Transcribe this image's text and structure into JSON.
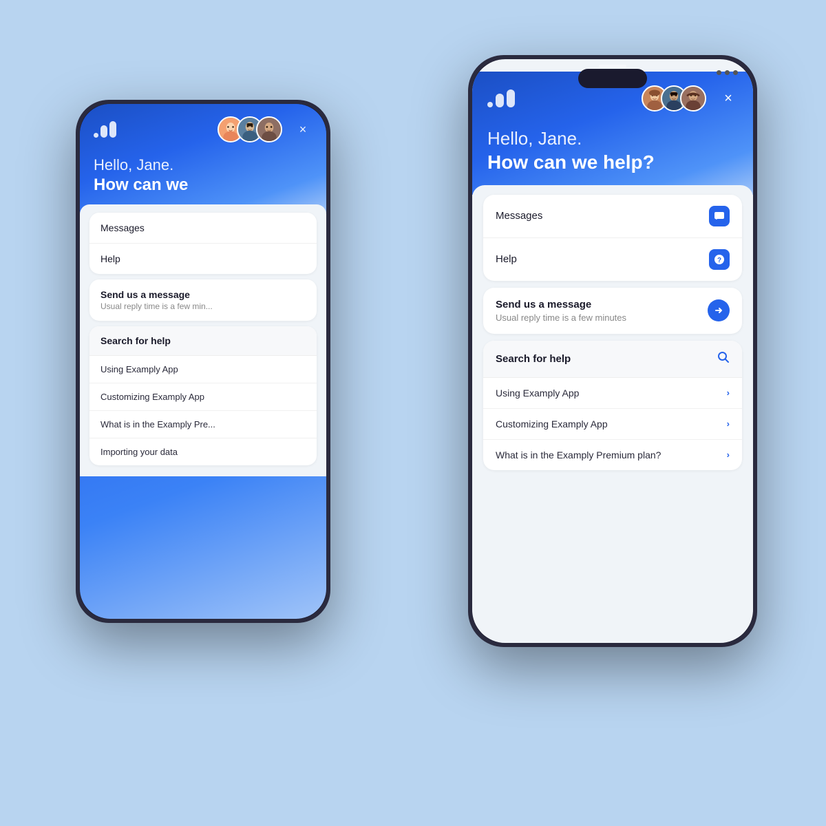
{
  "background_color": "#b8d4f0",
  "back_phone": {
    "greeting_light": "Hello, Jane.",
    "greeting_bold": "How can we",
    "tabs": {
      "messages": "Messages",
      "help": "Help"
    },
    "send_message": {
      "title": "Send us a message",
      "subtitle": "Usual reply time is a few min..."
    },
    "search_for_help": {
      "label": "Search for help",
      "items": [
        "Using Examply App",
        "Customizing Examply App",
        "What is in the Examply Pre...",
        "Importing your data"
      ]
    }
  },
  "front_phone": {
    "greeting_light": "Hello, Jane.",
    "greeting_bold": "How can we help?",
    "tabs": {
      "messages": "Messages",
      "help": "Help"
    },
    "send_message": {
      "title": "Send us a message",
      "subtitle": "Usual reply time is a few minutes"
    },
    "search_for_help": {
      "label": "Search for help",
      "items": [
        "Using Examply App",
        "Customizing Examply App",
        "What is in the Examply Premium plan?"
      ]
    }
  },
  "close_btn_label": "×",
  "chevron_right": "›",
  "icons": {
    "messages": "💬",
    "help": "❓",
    "arrow": "▶",
    "search": "🔍"
  }
}
